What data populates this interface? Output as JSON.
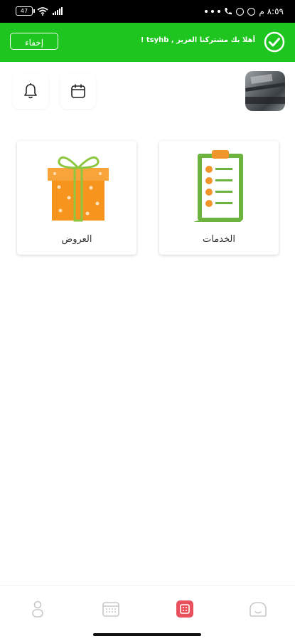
{
  "status_bar": {
    "battery": "47",
    "time": "٨:٥٩ م"
  },
  "banner": {
    "hide_button": "إخفاء",
    "welcome_text": "أهلا بك مشتركنا العزيز , tsyhb !"
  },
  "cards": [
    {
      "label": "الخدمات",
      "icon": "clipboard-checklist-icon"
    },
    {
      "label": "العروض",
      "icon": "gift-box-icon"
    }
  ],
  "colors": {
    "banner": "#1fc51f",
    "nav_active": "#e8505b",
    "nav_inactive": "#c8c8c8"
  },
  "bottom_nav": [
    {
      "icon": "profile-icon",
      "active": false
    },
    {
      "icon": "calendar-icon",
      "active": false
    },
    {
      "icon": "dashboard-icon",
      "active": true
    },
    {
      "icon": "home-icon",
      "active": false
    }
  ]
}
